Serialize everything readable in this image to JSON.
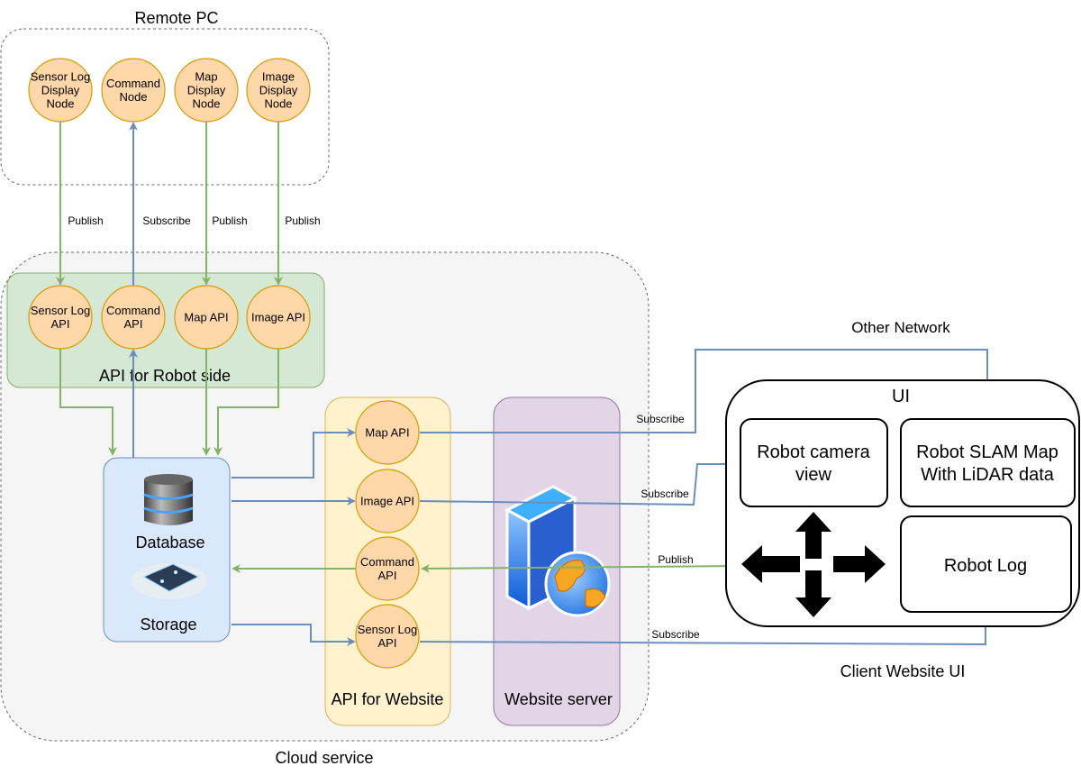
{
  "remote_pc": {
    "title": "Remote PC",
    "nodes": [
      {
        "lines": [
          "Sensor Log",
          "Display",
          "Node"
        ]
      },
      {
        "lines": [
          "Command",
          "Node"
        ]
      },
      {
        "lines": [
          "Map",
          "Display",
          "Node"
        ]
      },
      {
        "lines": [
          "Image",
          "Display",
          "Node"
        ]
      }
    ]
  },
  "edge_labels": {
    "publish": "Publish",
    "subscribe": "Subscribe"
  },
  "cloud_service": {
    "title": "Cloud service",
    "robot_api_group": {
      "title": "API for Robot side",
      "apis": [
        {
          "lines": [
            "Sensor Log",
            "API"
          ]
        },
        {
          "lines": [
            "Command",
            "API"
          ]
        },
        {
          "lines": [
            "Map API"
          ]
        },
        {
          "lines": [
            "Image API"
          ]
        }
      ]
    },
    "storage": {
      "database_label": "Database",
      "storage_label": "Storage"
    },
    "website_api_group": {
      "title": "API for Website",
      "apis": [
        {
          "lines": [
            "Map API"
          ]
        },
        {
          "lines": [
            "Image API"
          ]
        },
        {
          "lines": [
            "Command",
            "API"
          ]
        },
        {
          "lines": [
            "Sensor Log",
            "API"
          ]
        }
      ]
    },
    "website_server": {
      "title": "Website server"
    }
  },
  "other_network": "Other Network",
  "client_ui": {
    "title": "UI",
    "caption": "Client Website UI",
    "camera_view": [
      "Robot camera",
      "view"
    ],
    "slam_map": [
      "Robot SLAM Map",
      "With LiDAR data"
    ],
    "robot_log": "Robot Log"
  },
  "colors": {
    "publish_edge": "#82b366",
    "subscribe_edge": "#6c8ebf",
    "node_fill": "#ffd7a8",
    "robot_api_group": "#d5e8d4",
    "website_api_group": "#fff2cc",
    "website_server": "#e1d5e7",
    "storage": "#dae8fc"
  }
}
